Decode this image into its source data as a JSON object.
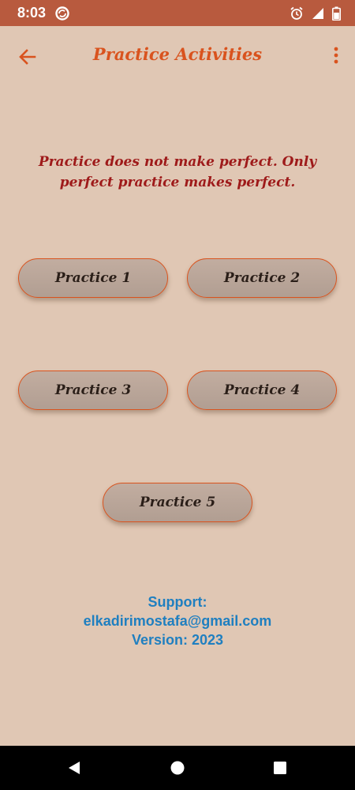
{
  "status_bar": {
    "time": "8:03",
    "icons": [
      "sync-icon",
      "alarm-icon",
      "signal-icon",
      "battery-icon"
    ]
  },
  "app_bar": {
    "title": "Practice Activities",
    "back_icon": "arrow-left-icon",
    "menu_icon": "more-vert-icon"
  },
  "quote": "Practice does not make perfect. Only perfect practice makes perfect.",
  "practice_buttons": [
    {
      "label": "Practice 1"
    },
    {
      "label": "Practice 2"
    },
    {
      "label": "Practice 3"
    },
    {
      "label": "Practice 4"
    },
    {
      "label": "Practice 5"
    }
  ],
  "support": {
    "label": "Support:",
    "email": "elkadirimostafa@gmail.com",
    "version": "Version: 2023"
  },
  "nav_bar": {
    "icons": [
      "nav-back-icon",
      "nav-home-icon",
      "nav-recents-icon"
    ]
  },
  "colors": {
    "background": "#e0c7b4",
    "status_bar": "#b85a3e",
    "accent": "#d9531e",
    "quote": "#9e1a1a",
    "support_text": "#1f7fc0",
    "button_fill": "#b8a497"
  }
}
